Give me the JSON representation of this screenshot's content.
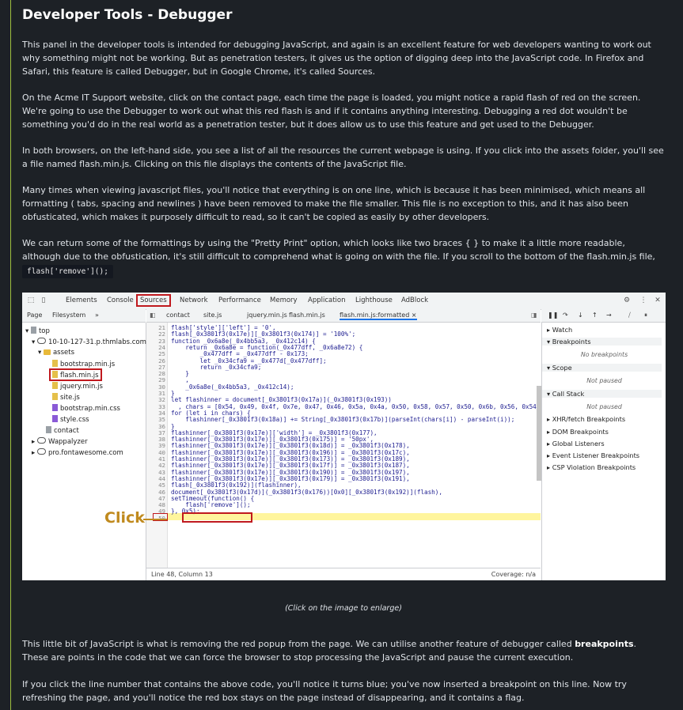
{
  "heading": "Developer Tools - Debugger",
  "paragraphs": [
    "This panel in the developer tools is intended for debugging JavaScript, and again is an excellent feature for web developers wanting to work out why something might not be working. But as penetration testers, it gives us the option of digging deep into the JavaScript code. In Firefox and Safari, this feature is called Debugger, but in Google Chrome, it's called Sources.",
    "On the Acme IT Support website, click on the contact page, each time the page is loaded, you might notice a rapid flash of red on the screen. We're going to use the Debugger to work out what this red flash is and if it contains anything interesting. Debugging a red dot wouldn't be something you'd do in the real world as a penetration tester, but it does allow us to use this feature and get used to the Debugger.",
    "In both browsers, on the left-hand side, you see a list of all the resources the current webpage is using. If you click into the assets folder, you'll see a file named flash.min.js. Clicking on this file displays the contents of the JavaScript file.",
    "Many times when viewing javascript files, you'll notice that everything is on one line, which is because it has been minimised, which means all formatting ( tabs, spacing and newlines ) have been removed to make the file smaller. This file is no exception to this, and it has also been obfusticated, which makes it purposely difficult to read, so it can't be copied as easily by other developers.",
    "We can return some of the formattings by using the \"Pretty Print\" option, which looks like two braces { } to make it a little more readable, although due to the obfustication, it's still difficult to comprehend what is going on with the file. If you scroll to the bottom of the flash.min.js file, you'll see the line:"
  ],
  "code_snippet": "flash['remove']();",
  "caption": "(Click on the image to enlarge)",
  "para_after_1_pre": "This little bit of JavaScript is what is removing the red popup from the page. We can utilise another feature of debugger called ",
  "para_after_1_bold": "breakpoints",
  "para_after_1_post": ". These are points in the code that we can force the browser to stop processing the JavaScript and pause the current execution.",
  "para_after_2": "If you click the line number that contains the above code, you'll notice it turns blue; you've now inserted a breakpoint on this line. Now try refreshing the page, and you'll notice the red box stays on the page instead of disappearing, and it contains a flag.",
  "devtools": {
    "tabs": [
      "Elements",
      "Console",
      "Sources",
      "Network",
      "Performance",
      "Memory",
      "Application",
      "Lighthouse",
      "AdBlock"
    ],
    "nav_tabs": [
      "Page",
      "Filesystem",
      "»"
    ],
    "file_tabs": [
      "contact",
      "site.js",
      "jquery.min.js",
      "flash.min.js",
      "flash.min.js:formatted ×"
    ],
    "tree": [
      "top",
      "10-10-127-31.p.thmlabs.com",
      "assets",
      "bootstrap.min.js",
      "flash.min.js",
      "jquery.min.js",
      "site.js",
      "bootstrap.min.css",
      "style.css",
      "contact",
      "Wappalyzer",
      "pro.fontawesome.com"
    ],
    "line_numbers": [
      "21",
      "22",
      "23",
      "24",
      "25",
      "26",
      "27",
      "28",
      "29",
      "30",
      "31",
      "32",
      "33",
      "34",
      "35",
      "36",
      "37",
      "38",
      "39",
      "40",
      "41",
      "42",
      "43",
      "44",
      "45",
      "46",
      "47",
      "48",
      "49",
      "50"
    ],
    "code_lines": [
      "flash['style']['left'] = '0',",
      "flash[_0x3801f3(0x17e)][_0x3801f3(0x174)] = '100%';",
      "function _0x6a8e(_0x4bb5a3, _0x412c14) {",
      "    return _0x6a8e = function(_0x477dff, _0x6a8e72) {",
      "        _0x477dff = _0x477dff - 0x173;",
      "        let _0x34cfa9 = _0x477d[_0x477dff];",
      "        return _0x34cfa9;",
      "    }",
      "    ,",
      "    _0x6a8e(_0x4bb5a3, _0x412c14);",
      "}",
      "let flashinner = document[_0x3801f3(0x17a)](_0x3801f3(0x193))",
      "  , chars = [0x54, 0x49, 0x4f, 0x7e, 0x47, 0x46, 0x5a, 0x4a, 0x50, 0x58, 0x57, 0x50, 0x6b, 0x56, 0x54",
      "for (let i in chars) {",
      "    flashinner[_0x3801f3(0x18a)] += String[_0x3801f3(0x17b)](parseInt(chars[i]) - parseInt(i));",
      "}",
      "flashinner[_0x3801f3(0x17e)]['width'] = _0x3801f3(0x177),",
      "flashinner[_0x3801f3(0x17e)][_0x3801f3(0x175)] = '50px',",
      "flashinner[_0x3801f3(0x17e)][_0x3801f3(0x18d)] = _0x3801f3(0x178),",
      "flashinner[_0x3801f3(0x17e)][_0x3801f3(0x196)] = _0x3801f3(0x17c),",
      "flashinner[_0x3801f3(0x17e)][_0x3801f3(0x173)] = _0x3801f3(0x189),",
      "flashinner[_0x3801f3(0x17e)][_0x3801f3(0x17f)] = _0x3801f3(0x187),",
      "flashinner[_0x3801f3(0x17e)][_0x3801f3(0x190)] = _0x3801f3(0x197),",
      "flashinner[_0x3801f3(0x17e)][_0x3801f3(0x179)] = _0x3801f3(0x191),",
      "flash[_0x3801f3(0x192)](flashinner),",
      "document[_0x3801f3(0x17d)](_0x3801f3(0x176))[0x0][_0x3801f3(0x192)](flash),",
      "setTimeout(function() {",
      "    flash['remove']();",
      "}, 0x5);",
      ""
    ],
    "status_left": "Line 48, Column 13",
    "status_right": "Coverage: n/a",
    "right_panel": {
      "watch": "Watch",
      "breakpoints": "Breakpoints",
      "no_breakpoints": "No breakpoints",
      "scope": "Scope",
      "not_paused": "Not paused",
      "call_stack": "Call Stack",
      "not_paused_2": "Not paused",
      "items": [
        "XHR/fetch Breakpoints",
        "DOM Breakpoints",
        "Global Listeners",
        "Event Listener Breakpoints",
        "CSP Violation Breakpoints"
      ]
    },
    "annotation": "Click"
  }
}
